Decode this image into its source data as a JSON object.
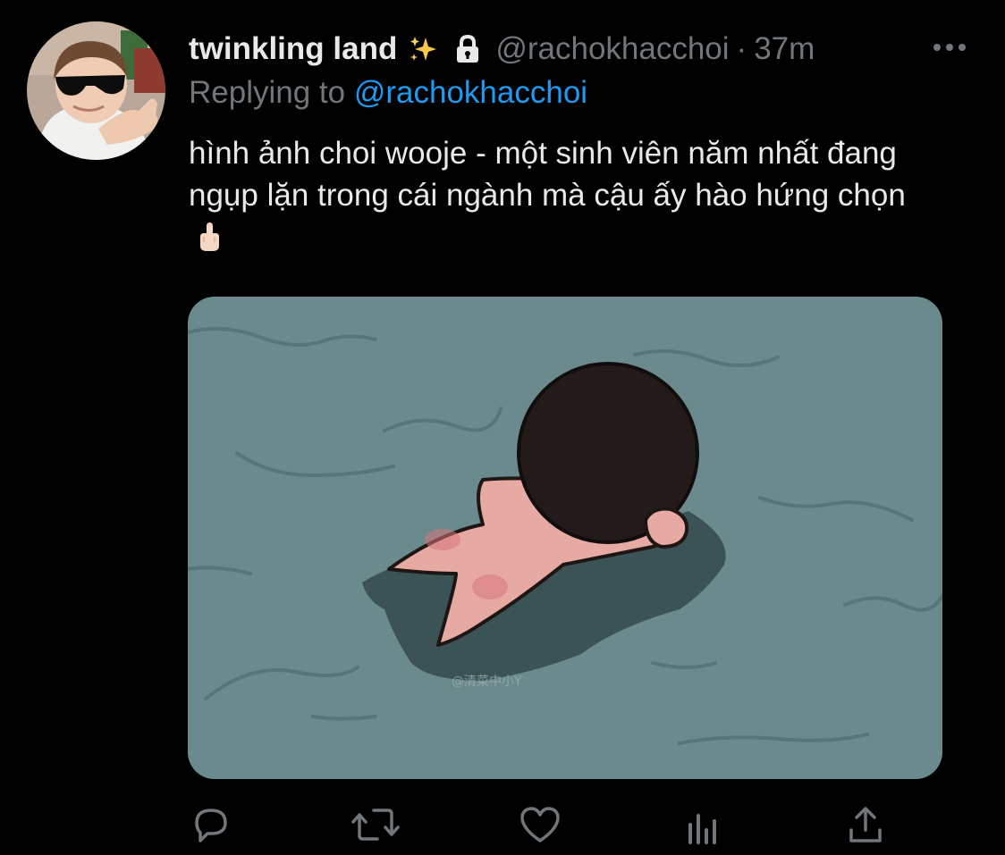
{
  "tweet": {
    "display_name": "twinkling land",
    "handle": "@rachokhacchoi",
    "separator": "·",
    "time": "37m",
    "replying_prefix": "Replying to",
    "replying_handle": "@rachokhacchoi",
    "text": "hình ảnh choi wooje - một sinh viên năm nhất đang ngụp lặn trong cái ngành mà cậu ấy hào hứng chọn",
    "emoji": "middle-finger-emoji",
    "badges": [
      "sparkles-icon",
      "lock-icon"
    ]
  },
  "media": {
    "watermark": "@清菜中小Y"
  },
  "actions": [
    {
      "name": "reply",
      "icon": "reply-icon"
    },
    {
      "name": "retweet",
      "icon": "retweet-icon"
    },
    {
      "name": "like",
      "icon": "heart-icon"
    },
    {
      "name": "analytics",
      "icon": "analytics-icon"
    },
    {
      "name": "share",
      "icon": "share-icon"
    }
  ],
  "colors": {
    "background": "#000000",
    "text": "#e7e9ea",
    "muted": "#71767b",
    "link": "#1d9bf0",
    "water": "#6a8a8d"
  }
}
